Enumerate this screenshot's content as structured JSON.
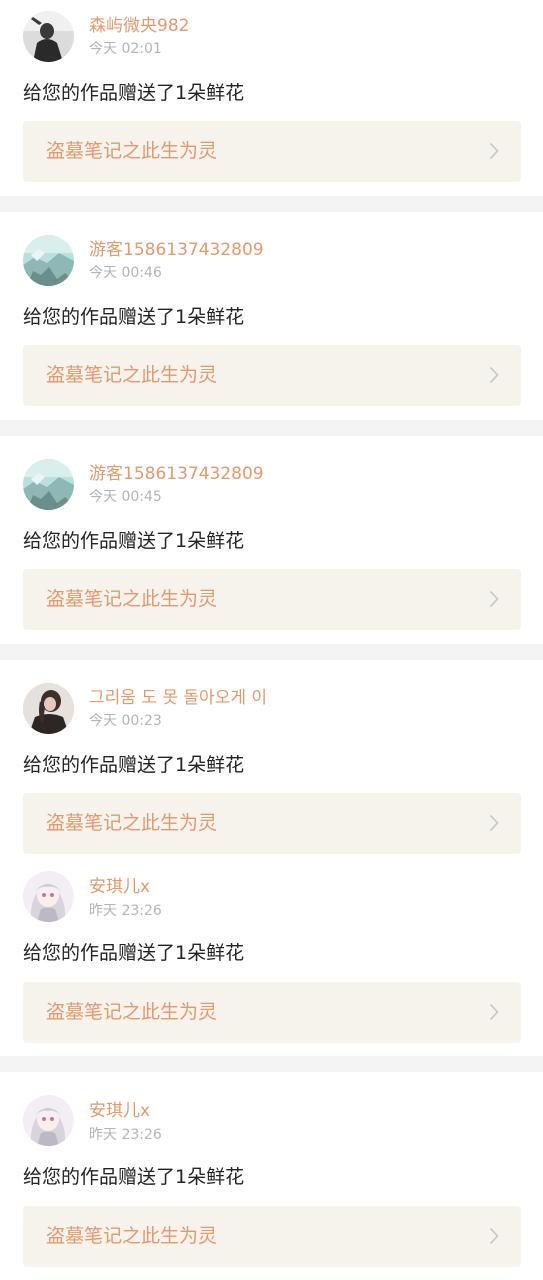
{
  "notifications": [
    {
      "user_name": "森屿微央982",
      "time": "今天 02:01",
      "message": "给您的作品赠送了1朵鲜花",
      "work_title": "盗墓笔记之此生为灵",
      "avatar": "avatar-bw-photo"
    },
    {
      "user_name": "游客1586137432809",
      "time": "今天 00:46",
      "message": "给您的作品赠送了1朵鲜花",
      "work_title": "盗墓笔记之此生为灵",
      "avatar": "avatar-teal-landscape"
    },
    {
      "user_name": "游客1586137432809",
      "time": "今天 00:45",
      "message": "给您的作品赠送了1朵鲜花",
      "work_title": "盗墓笔记之此生为灵",
      "avatar": "avatar-teal-landscape"
    },
    {
      "user_name": "그리움 도 못 돌아오게 이",
      "time": "今天 00:23",
      "message": "给您的作品赠送了1朵鲜花",
      "work_title": "盗墓笔记之此生为灵",
      "avatar": "avatar-dark-portrait"
    },
    {
      "user_name": "安琪儿x",
      "time": "昨天 23:26",
      "message": "给您的作品赠送了1朵鲜花",
      "work_title": "盗墓笔记之此生为灵",
      "avatar": "avatar-anime-girl"
    },
    {
      "user_name": "安琪儿x",
      "time": "昨天 23:26",
      "message": "给您的作品赠送了1朵鲜花",
      "work_title": "盗墓笔记之此生为灵",
      "avatar": "avatar-anime-girl"
    }
  ],
  "icons": {
    "work_link_arrow": "chevron-right-icon"
  },
  "colors": {
    "name_accent": "#e09a6e",
    "time_gray": "#b4b4b4",
    "link_bg": "#f5f3ec",
    "separator_bg": "#f4f4f4"
  }
}
